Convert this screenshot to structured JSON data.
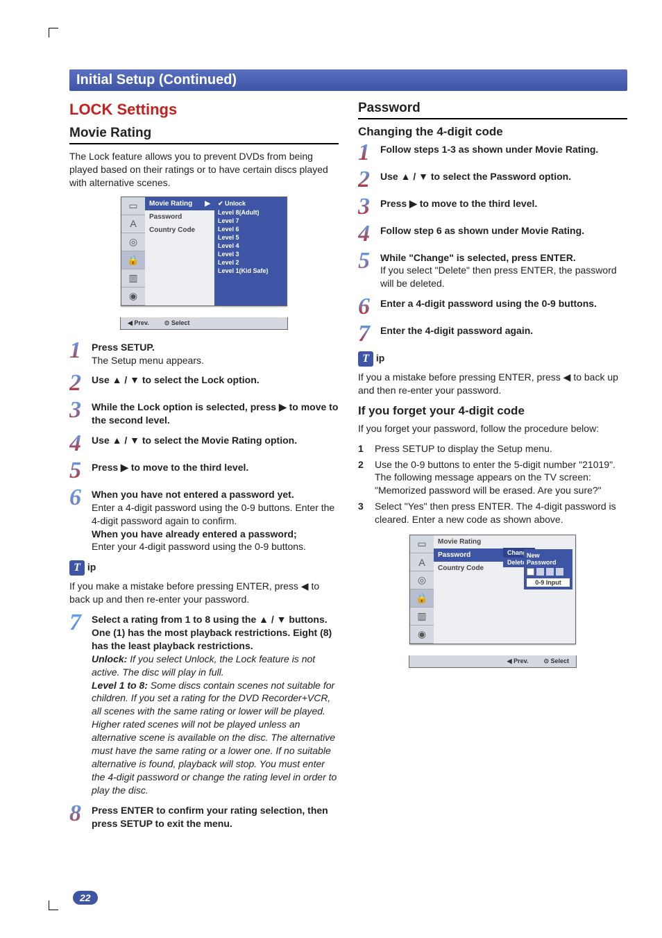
{
  "section_title": "Initial Setup (Continued)",
  "page_number": "22",
  "left": {
    "h2": "LOCK Settings",
    "h3": "Movie Rating",
    "intro": "The Lock feature allows you to prevent DVDs from being played based on their ratings or to have certain discs played with alternative scenes.",
    "osd1": {
      "mid_hi": "Movie Rating",
      "mid_arrow": "▶",
      "mid2": "Password",
      "mid3": "Country Code",
      "right_top": "✔ Unlock",
      "right": [
        "Level 8(Adult)",
        "Level 7",
        "Level 6",
        "Level 5",
        "Level 4",
        "Level 3",
        "Level 2",
        "Level 1(Kid Safe)"
      ],
      "foot_prev": "◀ Prev.",
      "foot_sel": "⊙ Select"
    },
    "steps": [
      {
        "n": "1",
        "b": "Press SETUP.",
        "t": "The Setup menu appears."
      },
      {
        "n": "2",
        "b": "Use ▲ / ▼ to select the Lock option.",
        "t": ""
      },
      {
        "n": "3",
        "b": "While the Lock option is selected, press ▶ to move to the second level.",
        "t": ""
      },
      {
        "n": "4",
        "b": "Use ▲ / ▼ to select the Movie Rating option.",
        "t": ""
      },
      {
        "n": "5",
        "b": "Press ▶ to move to the third level.",
        "t": ""
      },
      {
        "n": "6",
        "b": "When you have not entered a password yet.",
        "t": "Enter a 4-digit password using the 0-9 buttons. Enter the 4-digit password again to confirm.",
        "b2": "When you have already entered a password;",
        "t2": "Enter your 4-digit password using the 0-9 buttons."
      }
    ],
    "tip_label": "ip",
    "tip_text": "If you make a mistake before pressing ENTER, press ◀ to back up and then re-enter your password.",
    "step7": {
      "n": "7",
      "b": "Select a rating from 1 to 8 using the ▲ / ▼ buttons. One (1) has the most playback restrictions. Eight (8) has the least playback restrictions.",
      "unlock_b": "Unlock:",
      "unlock_t": " If you select Unlock, the Lock feature is not active. The disc will play in full.",
      "lvl_b": "Level 1 to 8:",
      "lvl_t": " Some discs contain scenes not suitable for children. If you set a rating for the DVD Recorder+VCR, all scenes with the same rating or lower will be played. Higher rated scenes will not be played unless an alternative scene is available on the disc. The alternative must have the same rating or a lower one. If no suitable alternative is found, playback will stop. You must enter the 4-digit password or change the rating level in order to play the disc."
    },
    "step8": {
      "n": "8",
      "b": "Press ENTER to confirm your rating selection, then press SETUP to exit the menu."
    }
  },
  "right": {
    "h3": "Password",
    "sub": "Changing the 4-digit code",
    "steps": [
      {
        "n": "1",
        "b": "Follow steps 1-3 as shown under Movie Rating."
      },
      {
        "n": "2",
        "b": "Use ▲ / ▼ to select the Password option."
      },
      {
        "n": "3",
        "b": "Press ▶ to move to the third level."
      },
      {
        "n": "4",
        "b": "Follow step 6 as shown under Movie Rating."
      },
      {
        "n": "5",
        "b": "While \"Change\" is selected, press ENTER.",
        "t": "If you select \"Delete\" then press ENTER, the password will be deleted."
      },
      {
        "n": "6",
        "b": "Enter a 4-digit password using the 0-9 buttons."
      },
      {
        "n": "7",
        "b": "Enter the 4-digit password again."
      }
    ],
    "tip_label": "ip",
    "tip_text": "If you a mistake before pressing ENTER, press ◀ to back up and then re-enter your password.",
    "forgot_h": "If you forget your 4-digit code",
    "forgot_intro": "If you forget your password, follow the procedure below:",
    "forgot_steps": [
      {
        "n": "1",
        "t": "Press SETUP to display the Setup menu."
      },
      {
        "n": "2",
        "t": "Use the 0-9 buttons to enter the 5-digit number \"21019\". The following message appears on the TV screen: \"Memorized password will be erased. Are you sure?\""
      },
      {
        "n": "3",
        "t": "Select \"Yes\" then press ENTER. The 4-digit password is cleared. Enter a new code as shown above."
      }
    ],
    "osd2": {
      "mid1": "Movie Rating",
      "mid_hi": "Password",
      "mid3": "Country Code",
      "pop_change": "Change",
      "pop_delete": "Delete",
      "pop_new": "New",
      "pop_pw": "Password",
      "pop_input": "0-9 Input",
      "foot_prev": "◀ Prev.",
      "foot_sel": "⊙ Select"
    }
  }
}
